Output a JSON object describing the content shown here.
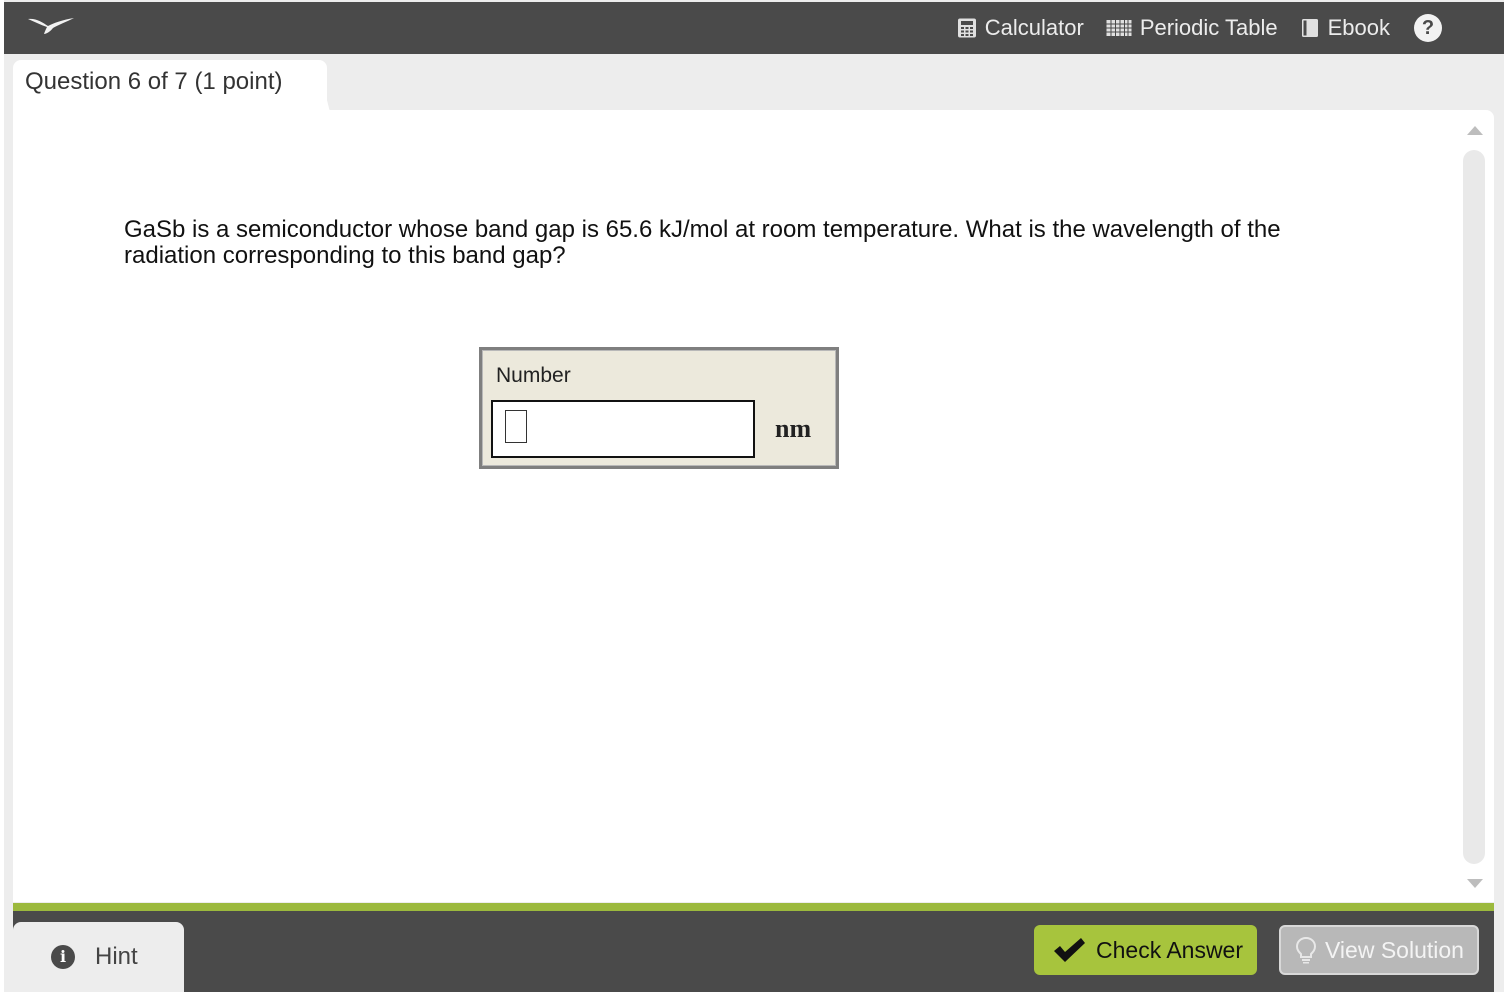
{
  "toolbar": {
    "tools": [
      {
        "label": "Calculator",
        "icon": "calculator-icon"
      },
      {
        "label": "Periodic Table",
        "icon": "periodic-table-icon"
      },
      {
        "label": "Ebook",
        "icon": "ebook-icon"
      }
    ],
    "help_icon": "help-icon",
    "help_glyph": "?"
  },
  "tab": {
    "label": "Question 6 of 7 (1 point)"
  },
  "question": {
    "text": "GaSb is a semiconductor whose band gap is 65.6 kJ/mol at room temperature. What is the wavelength of the radiation corresponding to this band gap?"
  },
  "answer": {
    "label": "Number",
    "value": "",
    "unit": "nm"
  },
  "footer": {
    "hint_label": "Hint",
    "hint_glyph": "i",
    "check_label": "Check Answer",
    "solution_label": "View Solution"
  },
  "colors": {
    "toolbar_bg": "#4a4a4a",
    "accent_green": "#9cb93d",
    "check_button": "#a7c43d",
    "answer_box_bg": "#ece9dc"
  }
}
